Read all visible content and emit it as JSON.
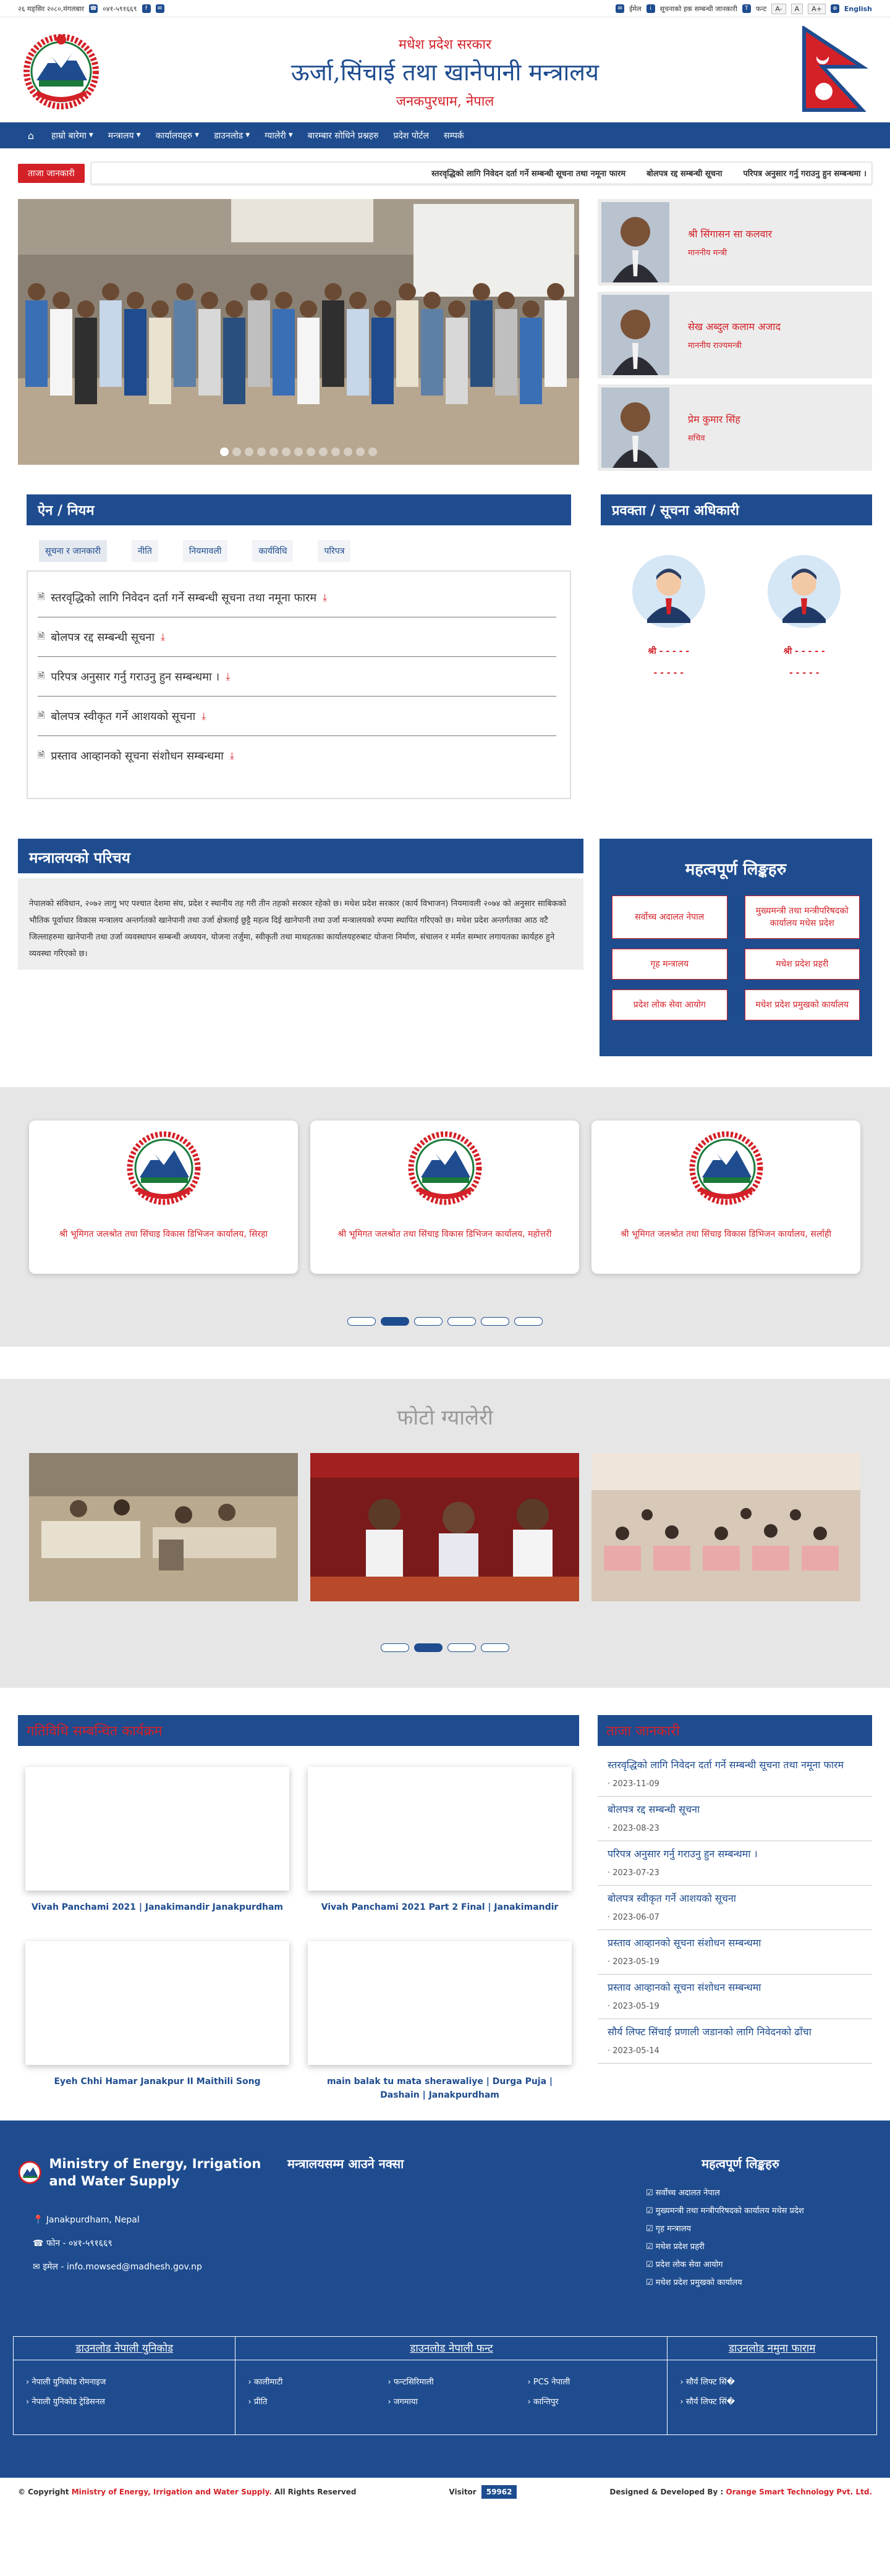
{
  "topbar": {
    "date": "२६ मङ्सिर २०८०,मंगलबार",
    "phone": "०४१-५९१६६९",
    "email_link": "ईमेल",
    "rti_link": "सूचनाको हक सम्बन्धी जानकारी",
    "font_link": "फन्ट",
    "font_small": "A-",
    "font_normal": "A",
    "font_big": "A+",
    "language": "English"
  },
  "header": {
    "subtitle": "मधेश प्रदेश सरकार",
    "title": "ऊर्जा,सिंचाई तथा खानेपानी मन्त्रालय",
    "location": "जनकपुरधाम, नेपाल"
  },
  "nav": {
    "home_icon": "home-icon",
    "items": [
      {
        "label": "हाम्रो बारेमा",
        "dropdown": true
      },
      {
        "label": "मन्त्रालय",
        "dropdown": true
      },
      {
        "label": "कार्यालयहरु",
        "dropdown": true
      },
      {
        "label": "डाउनलोड",
        "dropdown": true
      },
      {
        "label": "ग्यालेरी",
        "dropdown": true
      },
      {
        "label": "बारम्बार सोधिने प्रश्नहरु",
        "dropdown": false
      },
      {
        "label": "प्रदेश पोर्टल",
        "dropdown": false
      },
      {
        "label": "सम्पर्क",
        "dropdown": false
      }
    ]
  },
  "ticker": {
    "label": "ताजा जानकारी",
    "items": [
      "स्तरवृद्धिको लागि निवेदन दर्ता गर्ने सम्बन्धी सूचना तथा नमूना फारम",
      "बोलपत्र रद्द सम्बन्धी सूचना",
      "परिपत्र अनुसार गर्नु गराउनु हुन सम्बन्धमा ।"
    ]
  },
  "slider": {
    "dot_count": 13,
    "active_dot": 0
  },
  "officials": [
    {
      "name": "श्री सिंगासन सा कलवार",
      "role": "माननीय मन्त्री"
    },
    {
      "name": "सेख अब्दुल कलाम अजाद",
      "role": "माननीय राज्यमन्त्री"
    },
    {
      "name": "प्रेम कुमार सिंह",
      "role": "सचिव"
    }
  ],
  "acts": {
    "title": "ऐन / नियम",
    "tabs": [
      "सूचना र जानकारी",
      "नीति",
      "नियमावली",
      "कार्यविधि",
      "परिपत्र"
    ],
    "active_tab": 0,
    "items": [
      "स्तरवृद्धिको लागि निवेदन दर्ता गर्ने सम्बन्धी सूचना तथा नमूना फारम",
      "बोलपत्र रद्द सम्बन्धी सूचना",
      "परिपत्र अनुसार गर्नु गराउनु हुन सम्बन्धमा ।",
      "बोलपत्र स्वीकृत गर्ने आशयको सूचना",
      "प्रस्ताव आव्हानको सूचना संशोधन सम्बन्धमा"
    ]
  },
  "spokespersons": {
    "title": "प्रवक्ता / सूचना अधिकारी",
    "people": [
      {
        "name": "श्री - - - - -",
        "phone": "- - - - -"
      },
      {
        "name": "श्री - - - - -",
        "phone": "- - - - -"
      }
    ]
  },
  "about": {
    "title": "मन्त्रालयको परिचय",
    "text": "नेपालको संविधान, २०७२ लागु भए पश्चात देशमा संघ, प्रदेश र स्थानीय तह गरी तीन तहको सरकार रहेको छ। मधेश प्रदेश सरकार (कार्य विभाजन) नियमावली २०७४ को अनुसार साबिकको भौतिक पूर्वाधार विकास मन्त्रालय अन्तर्गतको खानेपानी तथा उर्जा क्षेत्रलाई छुट्टै महत्व दिई खानेपानी तथा उर्जा मन्त्रालयको रुपमा स्थापित गरिएको छ। मधेश प्रदेश अन्तर्गतका आठ वटै जिल्लाहरुमा खानेपानी तथा उर्जा व्यवस्थापन सम्बन्धी अध्ययन, योजना तर्जुमा, स्वीकृती तथा माथहतका कार्यालयहरुबाट योजना निर्माण, संचालन र मर्मत सम्भार लगायतका कार्यहरु हुने व्यवस्था गरिएको छ।"
  },
  "important_links": {
    "title": "महत्वपूर्ण लिङ्कहरु",
    "items": [
      "सर्वोच्च अदालत नेपाल",
      "मुख्यमन्त्री तथा मन्त्रीपरिषदको कार्यालय मधेस प्रदेश",
      "गृह मन्त्रालय",
      "मधेश प्रदेश प्रहरी",
      "प्रदेश लोक सेवा आयोग",
      "मधेश प्रदेश प्रमुखको कार्यालय"
    ]
  },
  "offices": {
    "items": [
      "श्री भूमिगत जलश्रोत तथा सिंचाइ विकास डिभिजन कार्यालय, सिरहा",
      "श्री भूमिगत जलश्रोत तथा सिंचाइ विकास डिभिजन कार्यालय, महोत्तरी",
      "श्री भूमिगत जलश्रोत तथा सिंचाइ विकास डिभिजन कार्यालय, सर्लाही"
    ],
    "dot_count": 6,
    "active_dot": 1
  },
  "gallery": {
    "title": "फोटो ग्यालेरी",
    "dot_count": 4,
    "active_dot": 1
  },
  "videos": {
    "title": "गतिविधि सम्बन्धित कार्यक्रम",
    "items": [
      "Vivah Panchami 2021 | Janakimandir Janakpurdham",
      "Vivah Panchami 2021 Part 2 Final | Janakimandir",
      "Eyeh Chhi Hamar Janakpur II Maithili Song",
      "main balak tu mata sherawaliye | Durga Puja | Dashain | Janakpurdham"
    ]
  },
  "latest": {
    "title": "ताजा जानकारी",
    "items": [
      {
        "title": "स्तरवृद्धिको लागि निवेदन दर्ता गर्ने सम्बन्धी सूचना तथा नमूना फारम",
        "date": "2023-11-09"
      },
      {
        "title": "बोलपत्र रद्द सम्बन्धी सूचना",
        "date": "2023-08-23"
      },
      {
        "title": "परिपत्र अनुसार गर्नु गराउनु हुन सम्बन्धमा ।",
        "date": "2023-07-23"
      },
      {
        "title": "बोलपत्र स्वीकृत गर्ने आशयको सूचना",
        "date": "2023-06-07"
      },
      {
        "title": "प्रस्ताव आव्हानको सूचना संशोधन सम्बन्धमा",
        "date": "2023-05-19"
      },
      {
        "title": "प्रस्ताव आव्हानको सूचना संशोधन सम्बन्धमा",
        "date": "2023-05-19"
      },
      {
        "title": "सौर्य लिफ्ट सिंचाई प्रणाली जडानको लागि निवेदनको ढाँचा",
        "date": "2023-05-14"
      }
    ]
  },
  "footer": {
    "org_name": "Ministry of Energy, Irrigation and Water Supply",
    "address": "Janakpurdham, Nepal",
    "phone": "फोन - ०४१-५९१६६९",
    "email": "इमेल - info.mowsed@madhesh.gov.np",
    "map_title": "मन्त्रालयसम्म आउने नक्सा",
    "links_title": "महत्वपूर्ण लिङ्कहरु",
    "links": [
      "सर्वोच्च अदालत नेपाल",
      "मुख्यमन्त्री तथा मन्त्रीपरिषदको कार्यालय मधेस प्रदेश",
      "गृह मन्त्रालय",
      "मधेश प्रदेश प्रहरी",
      "प्रदेश लोक सेवा आयोग",
      "मधेश प्रदेश प्रमुखको कार्यालय"
    ],
    "downloads": [
      {
        "title": "डाउनलोड नेपाली युनिकोड",
        "items": [
          "नेपाली युनिकोड रोमनाइज",
          "नेपाली युनिकोड ट्रेडिसनल"
        ]
      },
      {
        "title": "डाउनलोड नेपाली फन्ट",
        "items": [
          "कालीमाटी",
          "फन्टसिरिमाली",
          "PCS नेपाली",
          "प्रीति",
          "जगमाया",
          "कान्तिपुर"
        ]
      },
      {
        "title": "डाउनलोड नमुना फाराम",
        "items": [
          "सौर्य लिफ्ट सिं�",
          "सौर्य लिफ्ट सिं�"
        ]
      }
    ],
    "copyright_prefix": "© Copyright",
    "copyright_org": "Ministry of Energy, Irrigation and Water Supply.",
    "copyright_suffix": "All Rights Reserved",
    "visitor_label": "Visitor",
    "visitor_count": "59962",
    "designed_by": "Designed & Developed By :",
    "developer": "Orange Smart Technology Pvt. Ltd."
  },
  "colors": {
    "primary": "#1e4c8f",
    "accent": "#d42128",
    "panel": "#e6e6e6"
  }
}
